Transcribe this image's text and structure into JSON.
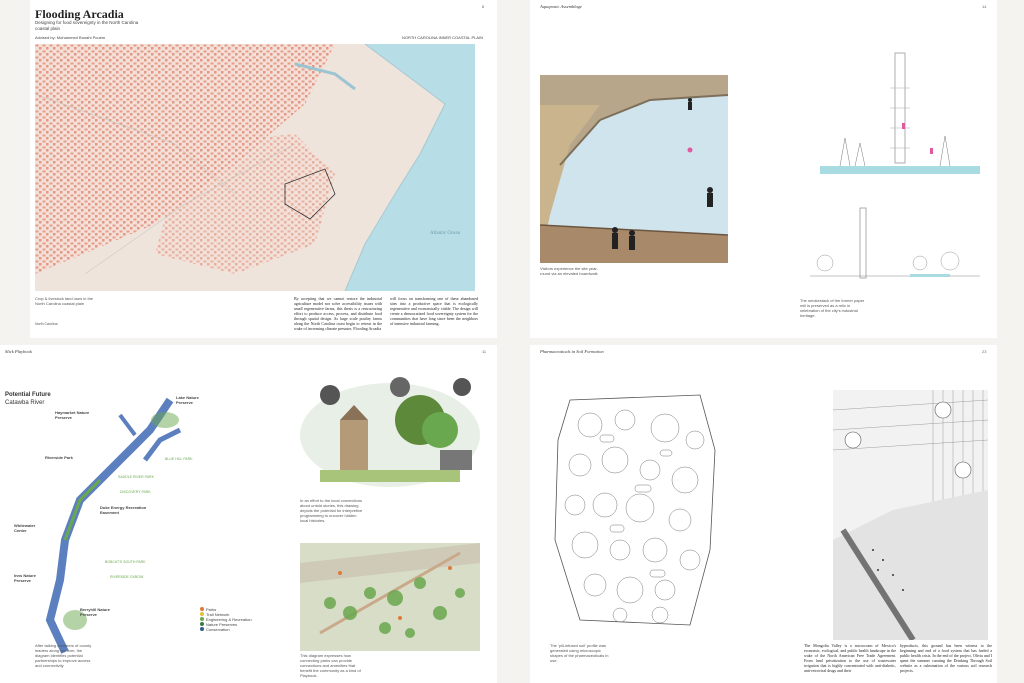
{
  "p1": {
    "title": "Flooding Arcadia",
    "subtitle": "Designing for food sovereignty in the North Carolina coastal plain",
    "advisor": "Advised by: Mohammed Bonahi Pouem",
    "region": "NORTH CAROLINA INNER COASTAL PLAIN",
    "page_num": "8",
    "map_caption": "Crop & livestock land uses in the North Carolina coastal plain",
    "footer": "North Carolina",
    "ocean_label": "Atlantic Ocean",
    "col1": "By accepting that we cannot restore the industrial agriculture model nor solve accessibility issues with small regenerative farms, this thesis is a restructuring effort to produce access, process, and distribute food through spatial design. As large scale poultry farms along the North Carolina coast begin to retreat in the wake of increasing climate pressure, Flooding Arcadia",
    "col2": "will focus on transforming one of these abandoned sites into a productive space that is ecologically regenerative and economically viable. The design will create a democratized food sovereignty system for the communities that have long since been the neighbors of intensive industrial farming."
  },
  "p2": {
    "title": "Aquaponic Assemblage",
    "page_num": "14",
    "photo_caption": "Visitors experience the site year-round via an elevated boardwalk",
    "elevation_caption": "The smokestack of the former paper mill is preserved as a relic in celebration of the city's industrial heritage."
  },
  "p3": {
    "title": "Slick Playbook",
    "page_num": "11",
    "map_title": "Potential Future",
    "map_subtitle": "Catawba River",
    "labels": [
      "Haymarket Nature Preserve",
      "Lake Nature Preserve",
      "Riverside Park",
      "Duke Energy Recreation Easement",
      "Whitewater Center",
      "Inns Nature Preserve",
      "Berryhill Nature Preserve"
    ],
    "green_labels": [
      "SADDLE RIVER PARK",
      "DISCOVERY PARK",
      "BOBCAT'S SOUTH PARK",
      "RIVERSIDE OXBOW",
      "BLUE HILL PARK"
    ],
    "legend": [
      "Parks",
      "Trail Network",
      "Engineering & Recreation",
      "Nature Preserves",
      "Conservation"
    ],
    "map_caption": "After talking members of county leaders along the river, the diagram identifies potential partnerships to improve access and connectivity",
    "collage_caption": "In an effort to the local connections about untold stories, this drawing depicts the potential for interpretive programming to uncover hidden local histories.",
    "plan_caption": "This diagram expresses how connecting parks can provide connections and amenities that benefit the community as a kind of Playbook."
  },
  "p4": {
    "title": "Pharmaceuticals in Soil Formation",
    "page_num": "23",
    "pattern_caption": "The 'pill-infused soil' profile was generated using microscopic shapes of the pharmaceuticals in use.",
    "col1": "The Mongolia Valley is a microcosm of Mexico's economic, ecological, and public health landscape in the wake of the North American Free Trade Agreement. From land privatization to the use of wastewater irrigation that is highly concentrated with anti-diabetic, anti-retroviral drugs and their",
    "col2": "byproducts, this ground has been witness to the beginning and end of a food system that has fueled a public health crisis. In the end of the project, Olivia and I spent the summer curating the Drinking Through Soil website as a culmination of the various soil research projects."
  },
  "colors": {
    "map_red": "#e07a63",
    "ocean": "#b7dde6",
    "river_blue": "#5c7fbf",
    "green": "#6aa84f",
    "pink": "#e05aa0"
  }
}
